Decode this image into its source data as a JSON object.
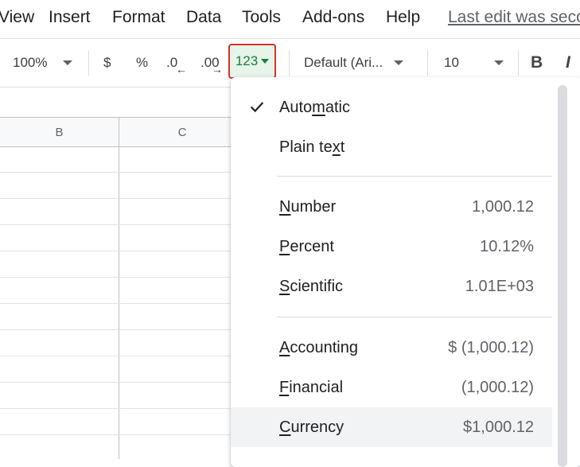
{
  "menubar": {
    "items": [
      "View",
      "Insert",
      "Format",
      "Data",
      "Tools",
      "Add-ons",
      "Help"
    ],
    "last_edit": "Last edit was seconds ago"
  },
  "toolbar": {
    "zoom": "100%",
    "currency_symbol": "$",
    "percent_symbol": "%",
    "decrease_decimal": ".0",
    "increase_decimal": ".00",
    "more_formats": "123",
    "font": "Default (Ari...",
    "font_size": "10",
    "bold": "B",
    "italic": "I"
  },
  "grid": {
    "columns": [
      "B",
      "C"
    ]
  },
  "format_menu": {
    "automatic": "Automatic",
    "plain_text": "Plain text",
    "items": [
      {
        "label": "Number",
        "value": "1,000.12"
      },
      {
        "label": "Percent",
        "value": "10.12%"
      },
      {
        "label": "Scientific",
        "value": "1.01E+03"
      },
      {
        "label": "Accounting",
        "value": "$ (1,000.12)"
      },
      {
        "label": "Financial",
        "value": "(1,000.12)"
      },
      {
        "label": "Currency",
        "value": "$1,000.12"
      }
    ]
  },
  "colors": {
    "highlight_border": "#d93025",
    "highlight_bg": "#e6f4ea",
    "accent_green": "#188038"
  }
}
